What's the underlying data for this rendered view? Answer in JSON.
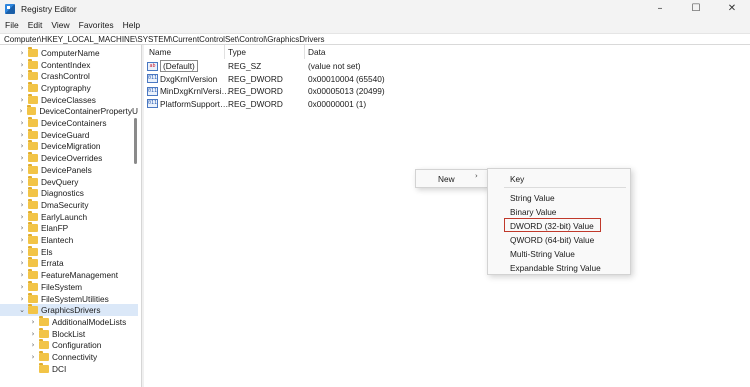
{
  "window": {
    "title": "Registry Editor",
    "controls": [
      "–",
      "☐",
      "✕"
    ]
  },
  "menubar": [
    "File",
    "Edit",
    "View",
    "Favorites",
    "Help"
  ],
  "address": "Computer\\HKEY_LOCAL_MACHINE\\SYSTEM\\CurrentControlSet\\Control\\GraphicsDrivers",
  "tree": {
    "items": [
      {
        "label": "ComputerName",
        "level": 1,
        "expanded": false
      },
      {
        "label": "ContentIndex",
        "level": 1,
        "expanded": false
      },
      {
        "label": "CrashControl",
        "level": 1,
        "expanded": false
      },
      {
        "label": "Cryptography",
        "level": 1,
        "expanded": false
      },
      {
        "label": "DeviceClasses",
        "level": 1,
        "expanded": false
      },
      {
        "label": "DeviceContainerPropertyU",
        "level": 1,
        "expanded": false
      },
      {
        "label": "DeviceContainers",
        "level": 1,
        "expanded": false
      },
      {
        "label": "DeviceGuard",
        "level": 1,
        "expanded": false
      },
      {
        "label": "DeviceMigration",
        "level": 1,
        "expanded": false
      },
      {
        "label": "DeviceOverrides",
        "level": 1,
        "expanded": false
      },
      {
        "label": "DevicePanels",
        "level": 1,
        "expanded": false
      },
      {
        "label": "DevQuery",
        "level": 1,
        "expanded": false
      },
      {
        "label": "Diagnostics",
        "level": 1,
        "expanded": false
      },
      {
        "label": "DmaSecurity",
        "level": 1,
        "expanded": false
      },
      {
        "label": "EarlyLaunch",
        "level": 1,
        "expanded": false
      },
      {
        "label": "ElanFP",
        "level": 1,
        "expanded": false
      },
      {
        "label": "Elantech",
        "level": 1,
        "expanded": false
      },
      {
        "label": "Els",
        "level": 1,
        "expanded": false
      },
      {
        "label": "Errata",
        "level": 1,
        "expanded": false
      },
      {
        "label": "FeatureManagement",
        "level": 1,
        "expanded": false
      },
      {
        "label": "FileSystem",
        "level": 1,
        "expanded": false
      },
      {
        "label": "FileSystemUtilities",
        "level": 1,
        "expanded": false
      },
      {
        "label": "GraphicsDrivers",
        "level": 1,
        "expanded": true,
        "selected": true
      },
      {
        "label": "AdditionalModeLists",
        "level": 2,
        "expanded": false
      },
      {
        "label": "BlockList",
        "level": 2,
        "expanded": false
      },
      {
        "label": "Configuration",
        "level": 2,
        "expanded": false
      },
      {
        "label": "Connectivity",
        "level": 2,
        "expanded": false
      },
      {
        "label": "DCI",
        "level": 2,
        "expanded": false,
        "leaf": true
      }
    ]
  },
  "list": {
    "columns": [
      "Name",
      "Type",
      "Data"
    ],
    "rows": [
      {
        "name": "(Default)",
        "type": "REG_SZ",
        "data": "(value not set)",
        "icon": "string-value-icon",
        "icon_glyph": "ab"
      },
      {
        "name": "DxgKrnlVersion",
        "type": "REG_DWORD",
        "data": "0x00010004 (65540)",
        "icon": "binary-value-icon",
        "icon_glyph": "011"
      },
      {
        "name": "MinDxgKrnlVersi…",
        "type": "REG_DWORD",
        "data": "0x00005013 (20499)",
        "icon": "binary-value-icon",
        "icon_glyph": "011"
      },
      {
        "name": "PlatformSupport…",
        "type": "REG_DWORD",
        "data": "0x00000001 (1)",
        "icon": "binary-value-icon",
        "icon_glyph": "011"
      }
    ]
  },
  "context_menu": {
    "parent_item": "New",
    "parent_arrow": "›",
    "submenu": [
      "Key",
      "String Value",
      "Binary Value",
      "DWORD (32-bit) Value",
      "QWORD (64-bit) Value",
      "Multi-String Value",
      "Expandable String Value"
    ],
    "highlighted": "DWORD (32-bit) Value",
    "highlight_color": "#c0392b"
  },
  "colors": {
    "selection": "#dbe8f8",
    "folder": "#f2c447"
  }
}
